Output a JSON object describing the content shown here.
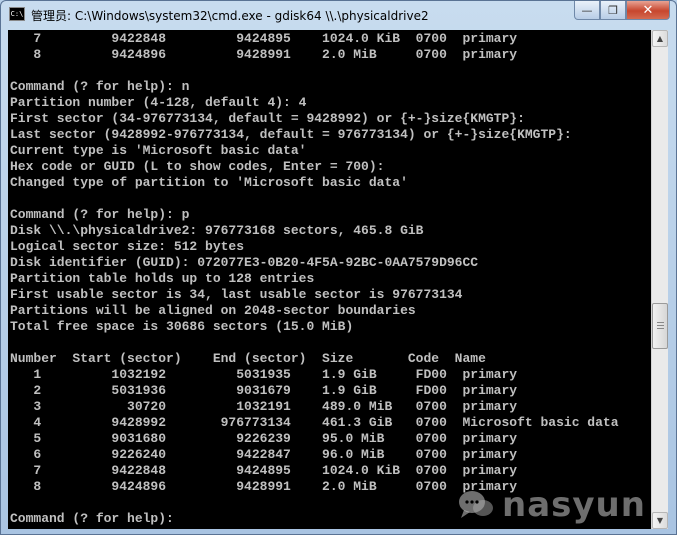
{
  "window": {
    "icon_text": "C:\\",
    "title": "管理员: C:\\Windows\\system32\\cmd.exe - gdisk64  \\\\.\\physicaldrive2",
    "minimize_glyph": "—",
    "restore_glyph": "❐",
    "close_glyph": "✕"
  },
  "console": {
    "lines": [
      "   7         9422848         9424895    1024.0 KiB  0700  primary",
      "   8         9424896         9428991    2.0 MiB     0700  primary",
      "",
      "Command (? for help): n",
      "Partition number (4-128, default 4): 4",
      "First sector (34-976773134, default = 9428992) or {+-}size{KMGTP}:",
      "Last sector (9428992-976773134, default = 976773134) or {+-}size{KMGTP}:",
      "Current type is 'Microsoft basic data'",
      "Hex code or GUID (L to show codes, Enter = 700):",
      "Changed type of partition to 'Microsoft basic data'",
      "",
      "Command (? for help): p",
      "Disk \\\\.\\physicaldrive2: 976773168 sectors, 465.8 GiB",
      "Logical sector size: 512 bytes",
      "Disk identifier (GUID): 072077E3-0B20-4F5A-92BC-0AA7579D96CC",
      "Partition table holds up to 128 entries",
      "First usable sector is 34, last usable sector is 976773134",
      "Partitions will be aligned on 2048-sector boundaries",
      "Total free space is 30686 sectors (15.0 MiB)",
      "",
      "Number  Start (sector)    End (sector)  Size       Code  Name",
      "   1         1032192         5031935    1.9 GiB     FD00  primary",
      "   2         5031936         9031679    1.9 GiB     FD00  primary",
      "   3           30720         1032191    489.0 MiB   0700  primary",
      "   4         9428992       976773134    461.3 GiB   0700  Microsoft basic data",
      "   5         9031680         9226239    95.0 MiB    0700  primary",
      "   6         9226240         9422847    96.0 MiB    0700  primary",
      "   7         9422848         9424895    1024.0 KiB  0700  primary",
      "   8         9424896         9428991    2.0 MiB     0700  primary",
      "",
      "Command (? for help): "
    ]
  },
  "scrollbar": {
    "up_glyph": "▲",
    "down_glyph": "▼",
    "position_fraction": 0.6
  },
  "watermark": {
    "text": "nasyun",
    "icon": "chat-bubbles-icon"
  }
}
